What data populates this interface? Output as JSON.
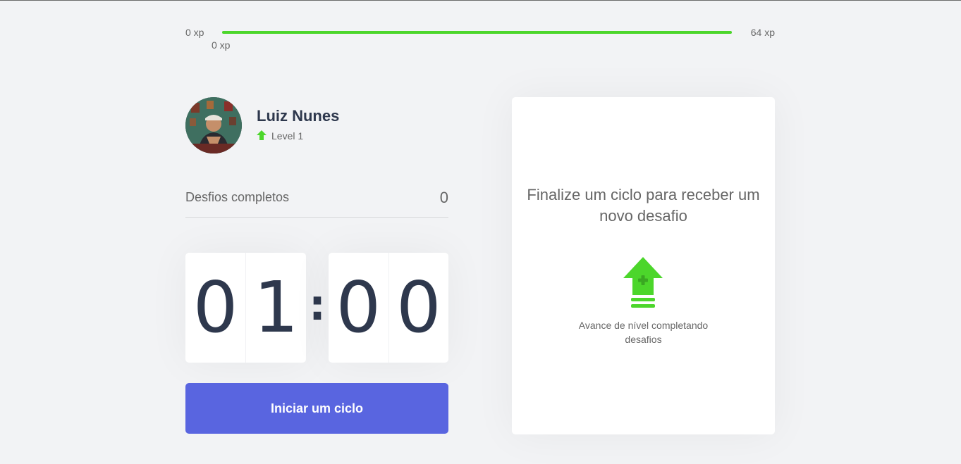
{
  "xp": {
    "min_label": "0 xp",
    "max_label": "64 xp",
    "current_label": "0 xp",
    "progress_fraction": 1.0
  },
  "profile": {
    "name": "Luiz Nunes",
    "level_label": "Level 1",
    "level_icon": "level-up-icon"
  },
  "completed": {
    "label": "Desfios completos",
    "value": "0"
  },
  "countdown": {
    "minute_left": "0",
    "minute_right": "1",
    "separator": ":",
    "second_left": "0",
    "second_right": "0"
  },
  "actions": {
    "start_label": "Iniciar um ciclo"
  },
  "challenge": {
    "title": "Finalize um ciclo para receber um novo desafio",
    "hint": "Avance de nível completando desafios",
    "icon": "level-up-icon"
  },
  "colors": {
    "accent_green": "#4cd62b",
    "button_blue": "#5965e0",
    "title_dark": "#2e384d",
    "background": "#f2f3f5"
  }
}
